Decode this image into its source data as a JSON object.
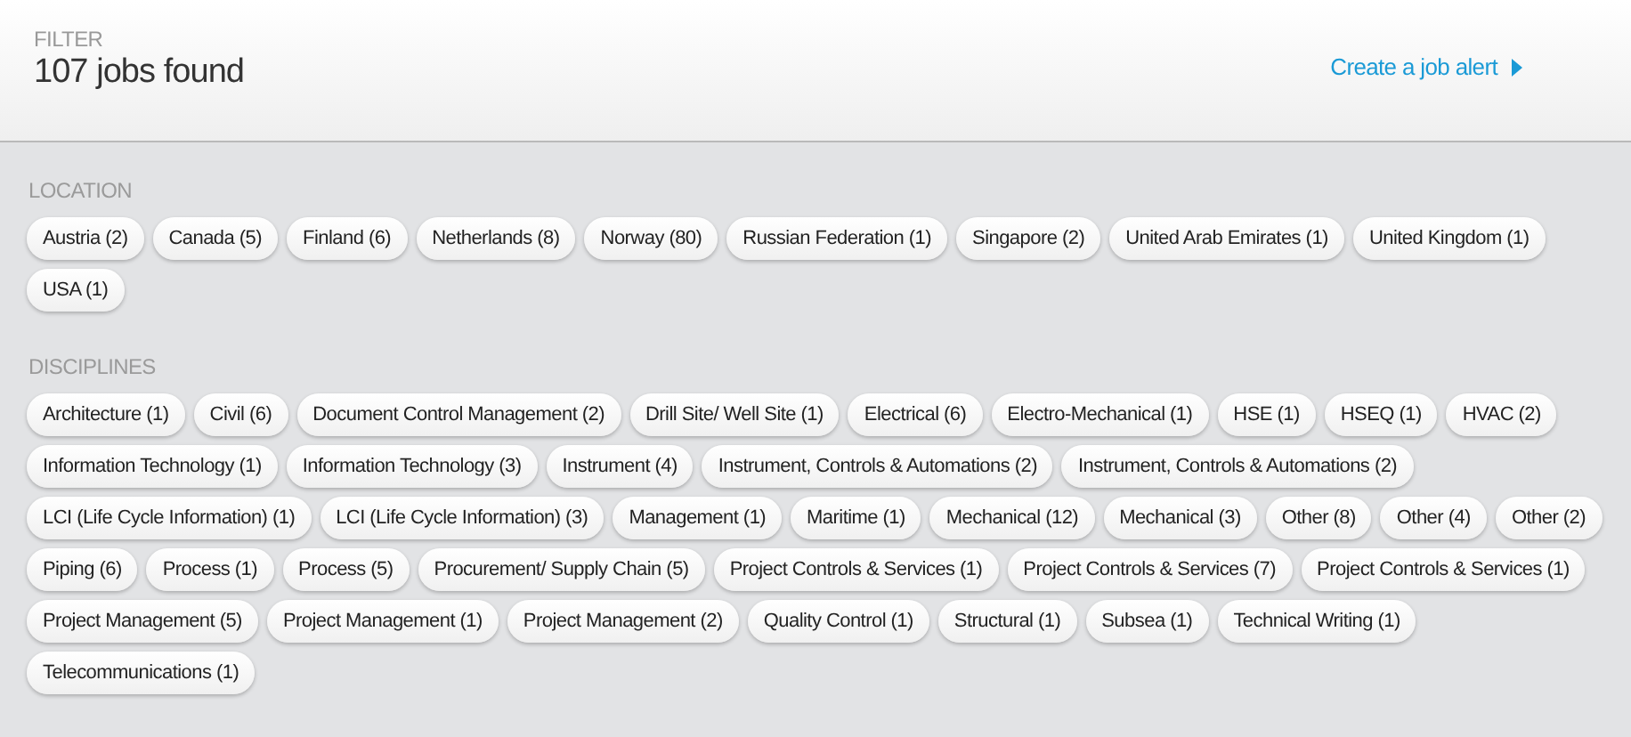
{
  "header": {
    "label": "FILTER",
    "title": "107 jobs found",
    "alert_link": "Create a job alert"
  },
  "sections": [
    {
      "title": "LOCATION",
      "chips": [
        "Austria (2)",
        "Canada (5)",
        "Finland (6)",
        "Netherlands (8)",
        "Norway (80)",
        "Russian Federation (1)",
        "Singapore (2)",
        "United Arab Emirates (1)",
        "United Kingdom (1)",
        "USA (1)"
      ]
    },
    {
      "title": "DISCIPLINES",
      "chips": [
        "Architecture (1)",
        "Civil (6)",
        "Document Control Management (2)",
        "Drill Site/ Well Site (1)",
        "Electrical (6)",
        "Electro-Mechanical (1)",
        "HSE (1)",
        "HSEQ (1)",
        "HVAC (2)",
        "Information Technology (1)",
        "Information Technology (3)",
        "Instrument (4)",
        "Instrument, Controls & Automations (2)",
        "Instrument, Controls & Automations (2)",
        "LCI (Life Cycle Information) (1)",
        "LCI (Life Cycle Information) (3)",
        "Management (1)",
        "Maritime (1)",
        "Mechanical (12)",
        "Mechanical (3)",
        "Other (8)",
        "Other (4)",
        "Other (2)",
        "Piping (6)",
        "Process (1)",
        "Process (5)",
        "Procurement/ Supply Chain (5)",
        "Project Controls & Services (1)",
        "Project Controls & Services (7)",
        "Project Controls & Services (1)",
        "Project Management (5)",
        "Project Management (1)",
        "Project Management (2)",
        "Quality Control (1)",
        "Structural (1)",
        "Subsea (1)",
        "Technical Writing (1)",
        "Telecommunications (1)"
      ]
    }
  ]
}
